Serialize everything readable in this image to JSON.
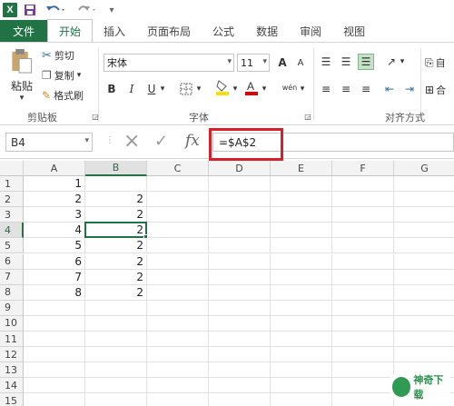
{
  "quick_access": {
    "logo_text": "X",
    "undo_icon": "undo-icon",
    "redo_icon": "redo-icon"
  },
  "tabs": [
    {
      "label": "文件"
    },
    {
      "label": "开始"
    },
    {
      "label": "插入"
    },
    {
      "label": "页面布局"
    },
    {
      "label": "公式"
    },
    {
      "label": "数据"
    },
    {
      "label": "审阅"
    },
    {
      "label": "视图"
    }
  ],
  "ribbon": {
    "clipboard": {
      "paste_label": "粘贴",
      "cut_label": "剪切",
      "copy_label": "复制",
      "format_painter_label": "格式刷",
      "group_label": "剪贴板"
    },
    "font": {
      "font_name": "宋体",
      "font_size": "11",
      "group_label": "字体",
      "bold": "B",
      "italic": "I",
      "underline": "U",
      "grow": "A",
      "shrink": "A",
      "phonetic_label": "wén"
    },
    "alignment": {
      "group_label": "对齐方式",
      "wrap_label": "自",
      "merge_label": "合"
    }
  },
  "formula_bar": {
    "name_box": "B4",
    "cancel_icon": "×",
    "enter_icon": "✓",
    "fx_label": "fx",
    "formula": "=$A$2"
  },
  "columns": [
    "A",
    "B",
    "C",
    "D",
    "E",
    "F",
    "G"
  ],
  "rows": [
    {
      "n": "1",
      "a": "1",
      "b": ""
    },
    {
      "n": "2",
      "a": "2",
      "b": "2"
    },
    {
      "n": "3",
      "a": "3",
      "b": "2"
    },
    {
      "n": "4",
      "a": "4",
      "b": "2"
    },
    {
      "n": "5",
      "a": "5",
      "b": "2"
    },
    {
      "n": "6",
      "a": "6",
      "b": "2"
    },
    {
      "n": "7",
      "a": "7",
      "b": "2"
    },
    {
      "n": "8",
      "a": "8",
      "b": "2"
    },
    {
      "n": "9",
      "a": "",
      "b": ""
    },
    {
      "n": "10",
      "a": "",
      "b": ""
    },
    {
      "n": "11",
      "a": "",
      "b": ""
    },
    {
      "n": "12",
      "a": "",
      "b": ""
    },
    {
      "n": "13",
      "a": "",
      "b": ""
    },
    {
      "n": "14",
      "a": "",
      "b": ""
    },
    {
      "n": "15",
      "a": "",
      "b": ""
    }
  ],
  "watermark": {
    "text": "神奇下载"
  },
  "colors": {
    "accent": "#217346",
    "highlight_box": "#d9202a"
  }
}
